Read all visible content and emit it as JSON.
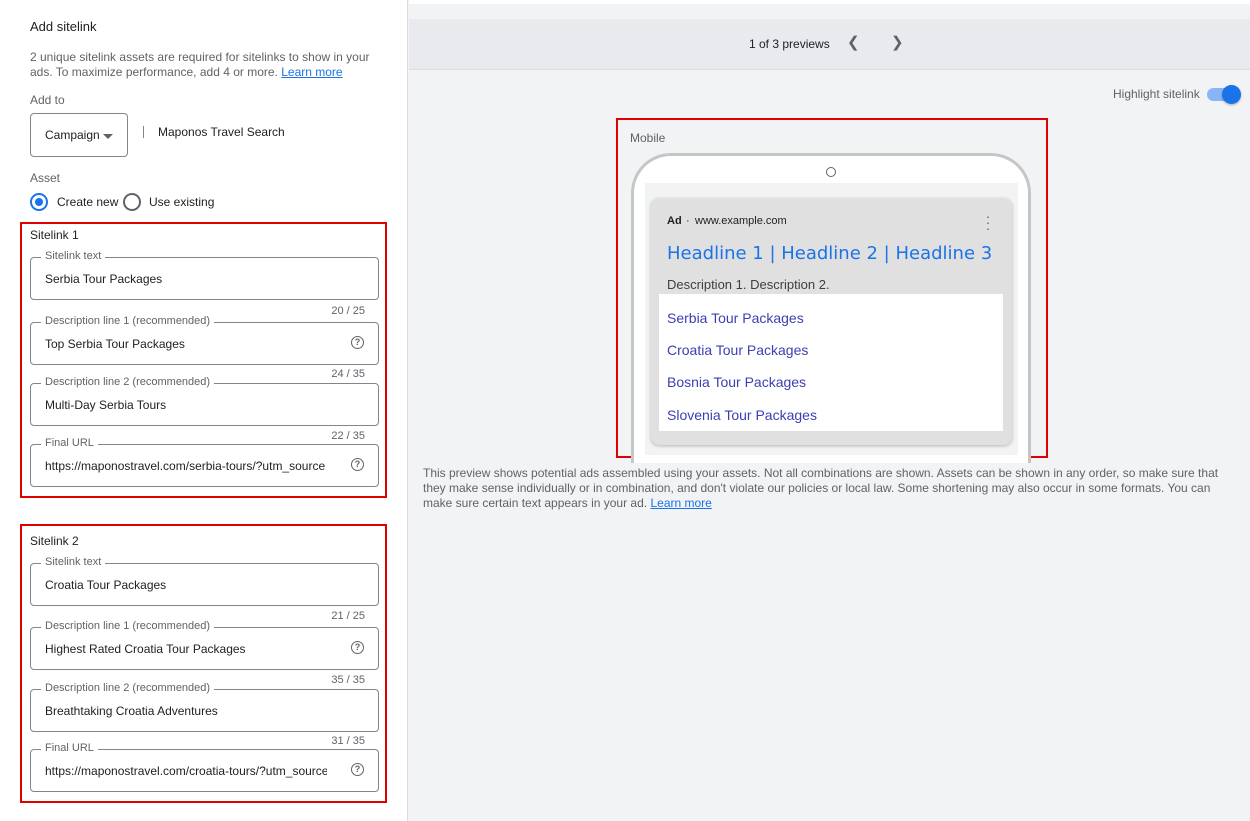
{
  "panel": {
    "title": "Add sitelink",
    "help_text": "2 unique sitelink assets are required for sitelinks to show in your ads. To maximize performance, add 4 or more.",
    "learn_more": "Learn more",
    "add_to_label": "Add to",
    "add_to_value": "Campaign",
    "campaign_name": "Maponos Travel Search",
    "asset_label": "Asset",
    "asset_options": [
      "Create new",
      "Use existing"
    ],
    "asset_selected": "Create new"
  },
  "sitelinks": [
    {
      "title": "Sitelink 1",
      "text_label": "Sitelink text",
      "text": "Serbia Tour Packages",
      "text_count": "20 / 25",
      "desc1_label": "Description line 1 (recommended)",
      "desc1": "Top Serbia Tour Packages",
      "desc1_count": "24 / 35",
      "desc2_label": "Description line 2 (recommended)",
      "desc2": "Multi-Day Serbia Tours",
      "desc2_count": "22 / 35",
      "url_label": "Final URL",
      "url": "https://maponostravel.com/serbia-tours/?utm_source"
    },
    {
      "title": "Sitelink 2",
      "text_label": "Sitelink text",
      "text": "Croatia Tour Packages",
      "text_count": "21 / 25",
      "desc1_label": "Description line 1 (recommended)",
      "desc1": "Highest Rated Croatia Tour Packages",
      "desc1_count": "35 / 35",
      "desc2_label": "Description line 2 (recommended)",
      "desc2": "Breathtaking Croatia Adventures",
      "desc2_count": "31 / 35",
      "url_label": "Final URL",
      "url": "https://maponostravel.com/croatia-tours/?utm_source"
    }
  ],
  "preview": {
    "count_label": "1 of 3 previews",
    "prev_icon": "chevron-left-icon",
    "next_icon": "chevron-right-icon",
    "highlight_label": "Highlight sitelink",
    "highlight_on": true,
    "device_label": "Mobile",
    "ad_tag": "Ad",
    "ad_url": "www.example.com",
    "headline": "Headline 1 | Headline 2 | Headline 3",
    "description": "Description 1. Description 2.",
    "sitelinks": [
      "Serbia Tour Packages",
      "Croatia Tour Packages",
      "Bosnia Tour Packages",
      "Slovenia Tour Packages"
    ],
    "disclaimer": "This preview shows potential ads assembled using your assets. Not all combinations are shown. Assets can be shown in any order, so make sure that they make sense individually or in combination, and don't violate our policies or local law. Some shortening may also occur in some formats. You can make sure certain text appears in your ad.",
    "learn_more": "Learn more"
  },
  "colors": {
    "accent": "#1a73e8",
    "highlight_border": "#e00000",
    "sitelink_color": "#3c3fb0"
  }
}
